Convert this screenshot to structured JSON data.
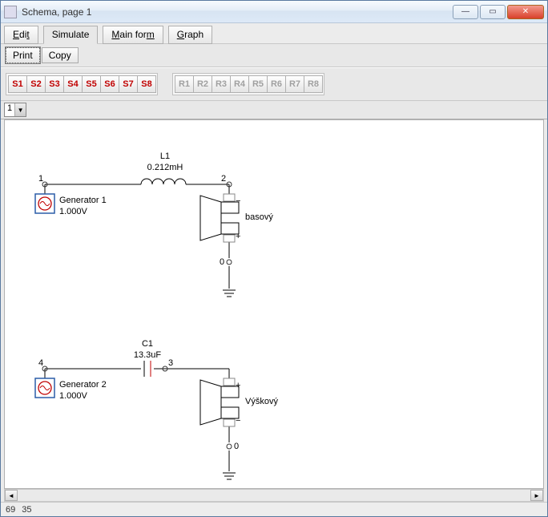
{
  "window": {
    "title": "Schema, page 1"
  },
  "tabs": {
    "edit": "Edit",
    "simulate": "Simulate",
    "mainform": "Main form",
    "graph": "Graph"
  },
  "toolbar": {
    "print": "Print",
    "copy": "Copy"
  },
  "slots": {
    "s": [
      "S1",
      "S2",
      "S3",
      "S4",
      "S5",
      "S6",
      "S7",
      "S8"
    ],
    "r": [
      "R1",
      "R2",
      "R3",
      "R4",
      "R5",
      "R6",
      "R7",
      "R8"
    ]
  },
  "page_selector": {
    "value": "1"
  },
  "status": {
    "x": "69",
    "y": "35"
  },
  "circuit1": {
    "inductor": {
      "name": "L1",
      "value": "0.212mH"
    },
    "generator": {
      "name": "Generator 1",
      "voltage": "1.000V"
    },
    "speaker": {
      "name": "basový"
    },
    "nodes": {
      "n1": "1",
      "n2": "2",
      "n0": "0"
    }
  },
  "circuit2": {
    "capacitor": {
      "name": "C1",
      "value": "13.3uF"
    },
    "generator": {
      "name": "Generator 2",
      "voltage": "1.000V"
    },
    "speaker": {
      "name": "Výškový"
    },
    "nodes": {
      "n4": "4",
      "n3": "3",
      "n0": "0"
    }
  }
}
